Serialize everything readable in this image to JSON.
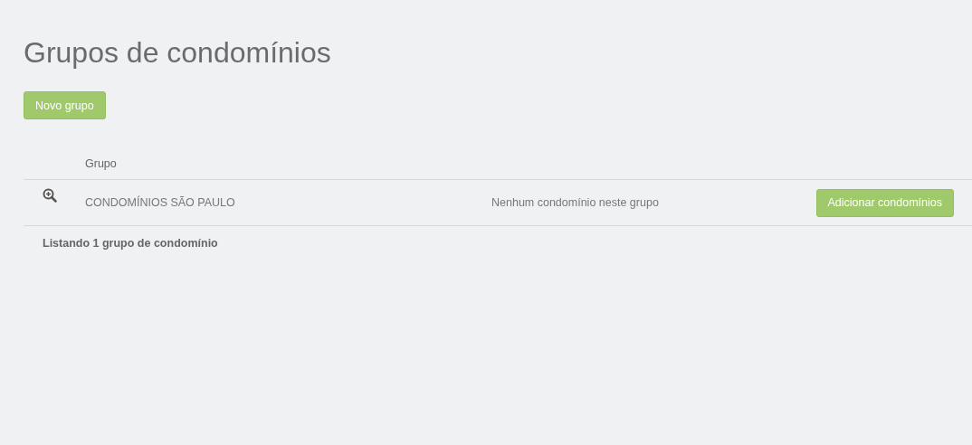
{
  "title": "Grupos de condomínios",
  "new_button": "Novo grupo",
  "table": {
    "columns": [
      {
        "label": "Grupo"
      }
    ],
    "rows": [
      {
        "name": "CONDOMÍNIOS SÃO PAULO",
        "status": "Nenhum condomínio neste grupo",
        "action": "Adicionar condomínios"
      }
    ]
  },
  "footer": "Listando 1 grupo de condomínio"
}
